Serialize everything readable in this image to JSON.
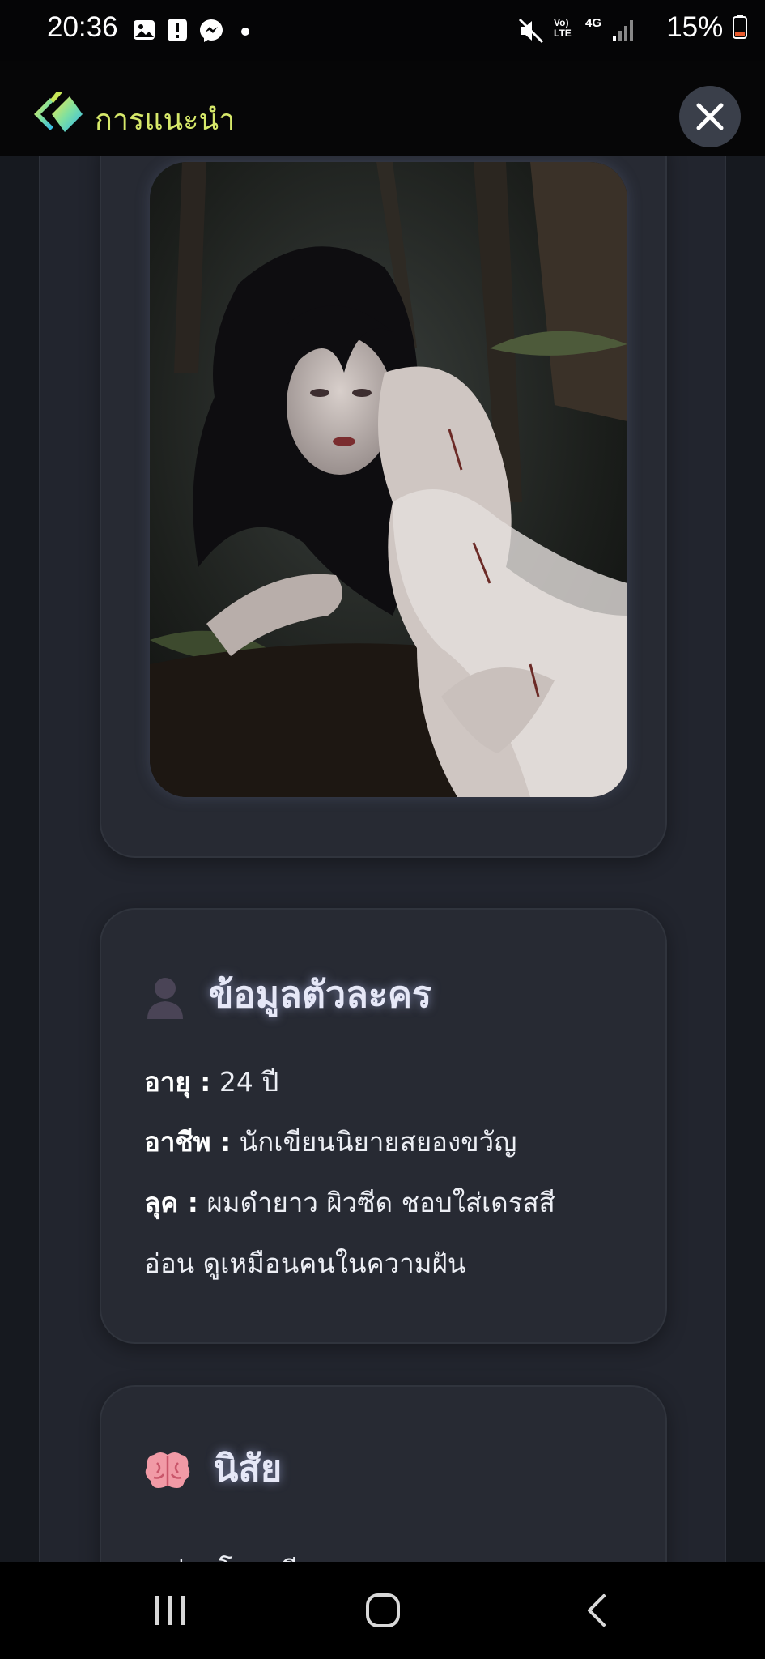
{
  "status_bar": {
    "time": "20:36",
    "battery": "15%",
    "icons": [
      "gallery-icon",
      "alert-icon",
      "messenger-icon",
      "dot-icon",
      "mute-icon",
      "volte-icon",
      "4g-icon",
      "signal-icon",
      "battery-icon"
    ],
    "network_label_1": "Vo) LTE",
    "network_label_2": "4G"
  },
  "header": {
    "title": "การแนะนำ",
    "close_icon": "close-icon",
    "accent_color": "#d6e86a"
  },
  "character_info": {
    "title": "ข้อมูลตัวละคร",
    "icon": "person-icon",
    "age_label": "อายุ :",
    "age_value": " 24 ปี",
    "occupation_label": "อาชีพ :",
    "occupation_value": " นักเขียนนิยายสยองขวัญ",
    "look_label": "ลุค :",
    "look_value_1": " ผมดำยาว ผิวซีด ชอบใส่เดรสสี",
    "look_value_2": "อ่อน ดูเหมือนคนในความฝัน"
  },
  "personality": {
    "title": "นิสัย",
    "icon": "brain-icon",
    "first_item": "• อ่อนโยน เงียบๆ"
  },
  "nav_bar": {
    "icons": [
      "recent-apps-icon",
      "home-icon",
      "back-icon"
    ]
  }
}
